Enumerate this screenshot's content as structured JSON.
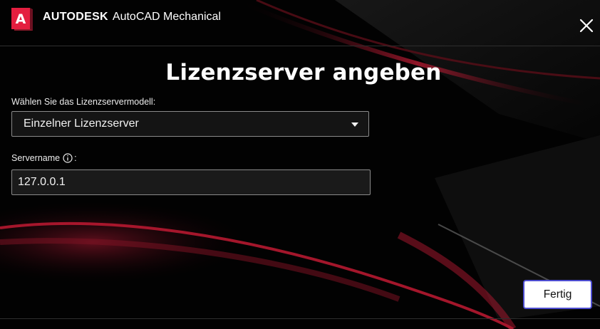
{
  "header": {
    "company": "AUTODESK",
    "product": "AutoCAD Mechanical",
    "logo_letter": "A",
    "logo_colors": {
      "front": "#e41e3f",
      "back": "#8f1a2b"
    },
    "close_icon": "close-icon"
  },
  "dialog": {
    "title": "Lizenzserver angeben",
    "model_label": "Wählen Sie das Lizenzservermodell:",
    "model_value": "Einzelner Lizenzserver",
    "server_label": "Servername",
    "server_label_suffix": ":",
    "server_value": "127.0.0.1",
    "info_icon": "info-icon"
  },
  "footer": {
    "done_label": "Fertig",
    "done_border_color": "#4d4dd1"
  }
}
